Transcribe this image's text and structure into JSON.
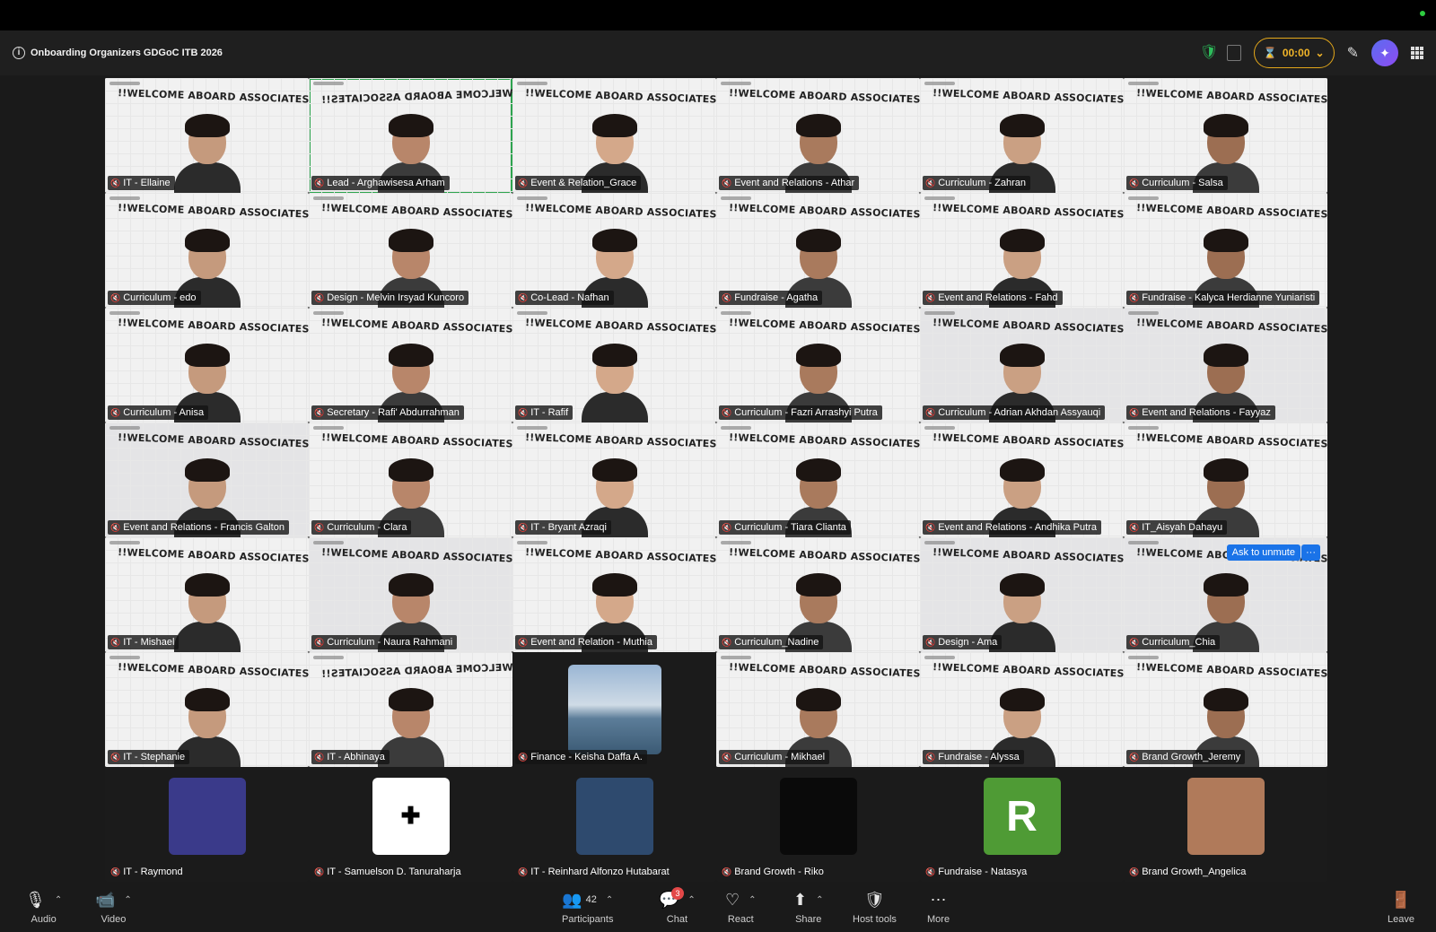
{
  "window": {
    "title": "Onboarding Organizers GDGoC ITB 2026",
    "timer": "00:00"
  },
  "banner_text": "!!WELCOME ABOARD ASSOCIATES!!",
  "tiles": [
    {
      "label": "IT - Ellaine"
    },
    {
      "label": "Lead - Arghawisesa Arham"
    },
    {
      "label": "Event & Relation_Grace"
    },
    {
      "label": "Event and Relations - Athar"
    },
    {
      "label": "Curriculum - Zahran"
    },
    {
      "label": "Curriculum - Salsa"
    },
    {
      "label": "Curriculum - edo"
    },
    {
      "label": "Design - Melvin Irsyad Kuncoro"
    },
    {
      "label": "Co-Lead - Nafhan"
    },
    {
      "label": "Fundraise - Agatha"
    },
    {
      "label": "Event and Relations - Fahd"
    },
    {
      "label": "Fundraise - Kalyca Herdianne Yuniaristi"
    },
    {
      "label": "Curriculum - Anisa"
    },
    {
      "label": "Secretary - Rafi' Abdurrahman"
    },
    {
      "label": "IT - Rafif"
    },
    {
      "label": "Curriculum - Fazri Arrashyi Putra"
    },
    {
      "label": "Curriculum - Adrian Akhdan Assyauqi"
    },
    {
      "label": "Event and Relations - Fayyaz"
    },
    {
      "label": "Event and Relations - Francis Galton"
    },
    {
      "label": "Curriculum - Clara"
    },
    {
      "label": "IT - Bryant Azraqi"
    },
    {
      "label": "Curriculum - Tiara Clianta"
    },
    {
      "label": "Event and Relations - Andhika Putra"
    },
    {
      "label": "IT_Aisyah Dahayu"
    },
    {
      "label": "IT - Mishael"
    },
    {
      "label": "Curriculum - Naura Rahmani"
    },
    {
      "label": "Event and Relation - Muthia"
    },
    {
      "label": "Curriculum_Nadine"
    },
    {
      "label": "Design - Ama"
    },
    {
      "label": "Curriculum_Chia"
    },
    {
      "label": "IT - Stephanie"
    },
    {
      "label": "IT - Abhinaya"
    },
    {
      "label": "Finance - Keisha Daffa A."
    },
    {
      "label": "Curriculum - Mikhael"
    },
    {
      "label": "Fundraise - Alyssa"
    },
    {
      "label": "Brand Growth_Jeremy"
    }
  ],
  "avatar_tiles": [
    {
      "label": "IT - Raymond"
    },
    {
      "label": "IT - Samuelson D. Tanuraharja"
    },
    {
      "label": "IT - Reinhard Alfonzo Hutabarat"
    },
    {
      "label": "Brand Growth - Riko"
    },
    {
      "label": "Fundraise - Natasya",
      "initial": "R"
    },
    {
      "label": "Brand Growth_Angelica"
    }
  ],
  "ask_to_unmute": "Ask to unmute",
  "more_dots": "···",
  "toolbar": {
    "audio": "Audio",
    "video": "Video",
    "participants": "Participants",
    "participants_count": "42",
    "chat": "Chat",
    "chat_badge": "3",
    "react": "React",
    "share": "Share",
    "host_tools": "Host tools",
    "more": "More",
    "leave": "Leave"
  },
  "colors": {
    "accent": "#1a73e8",
    "timer": "#f0b429",
    "active_speaker": "#2ea44f",
    "muted": "#e34848"
  }
}
